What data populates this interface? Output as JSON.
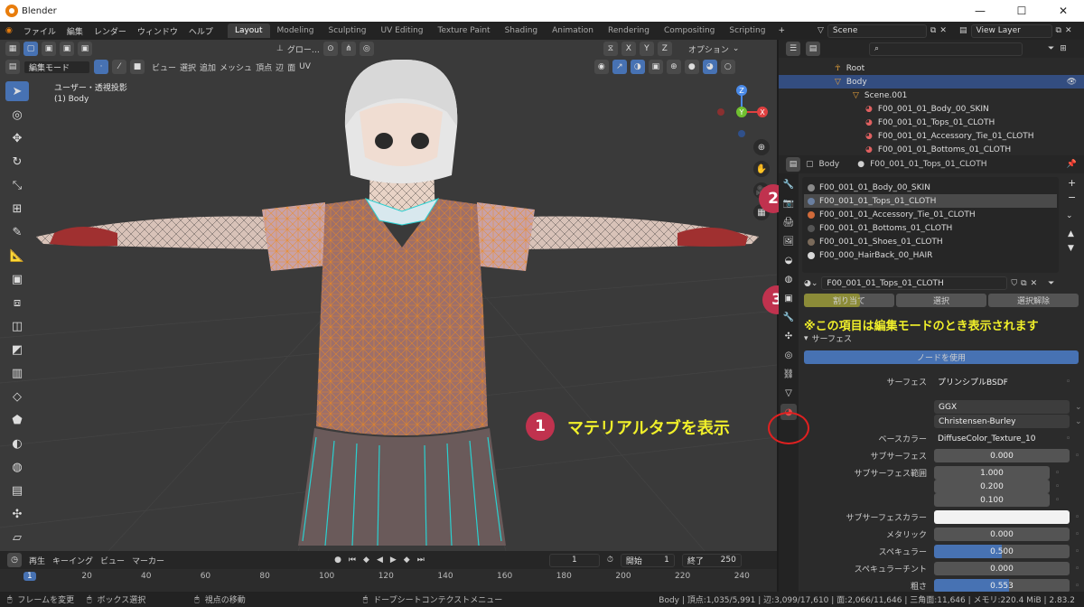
{
  "window": {
    "title": "Blender"
  },
  "menu": [
    "ファイル",
    "編集",
    "レンダー",
    "ウィンドウ",
    "ヘルプ"
  ],
  "workspace_tabs": [
    {
      "label": "Layout",
      "active": true
    },
    {
      "label": "Modeling",
      "active": false
    },
    {
      "label": "Sculpting",
      "active": false
    },
    {
      "label": "UV Editing",
      "active": false
    },
    {
      "label": "Texture Paint",
      "active": false
    },
    {
      "label": "Shading",
      "active": false
    },
    {
      "label": "Animation",
      "active": false
    },
    {
      "label": "Rendering",
      "active": false
    },
    {
      "label": "Compositing",
      "active": false
    },
    {
      "label": "Scripting",
      "active": false
    }
  ],
  "scene": {
    "name": "Scene",
    "view_layer": "View Layer"
  },
  "viewport": {
    "mode": "編集モード",
    "menus": [
      "ビュー",
      "選択",
      "追加",
      "メッシュ",
      "頂点",
      "辺",
      "面",
      "UV"
    ],
    "transform": "グロー…",
    "axes": [
      "X",
      "Y",
      "Z"
    ],
    "options": "オプション",
    "overlay_line1": "ユーザー・透視投影",
    "overlay_line2": "(1) Body",
    "gizmo_axes": {
      "x": "X",
      "y": "Y",
      "z": "Z"
    }
  },
  "outliner": {
    "rows": [
      {
        "label": "Root",
        "selected": false
      },
      {
        "label": "Body",
        "selected": true
      },
      {
        "label": "Scene.001",
        "selected": false
      },
      {
        "label": "F00_001_01_Body_00_SKIN",
        "selected": false
      },
      {
        "label": "F00_001_01_Tops_01_CLOTH",
        "selected": false
      },
      {
        "label": "F00_001_01_Accessory_Tie_01_CLOTH",
        "selected": false
      },
      {
        "label": "F00_001_01_Bottoms_01_CLOTH",
        "selected": false
      }
    ]
  },
  "properties": {
    "breadcrumb_object": "Body",
    "breadcrumb_material": "F00_001_01_Tops_01_CLOTH",
    "material_slots": [
      {
        "label": "F00_001_01_Body_00_SKIN",
        "color": "#8a8a8a",
        "selected": false
      },
      {
        "label": "F00_001_01_Tops_01_CLOTH",
        "color": "#6a7fa0",
        "selected": true
      },
      {
        "label": "F00_001_01_Accessory_Tie_01_CLOTH",
        "color": "#d06a3a",
        "selected": false
      },
      {
        "label": "F00_001_01_Bottoms_01_CLOTH",
        "color": "#555555",
        "selected": false
      },
      {
        "label": "F00_001_01_Shoes_01_CLOTH",
        "color": "#7a6a5a",
        "selected": false
      },
      {
        "label": "F00_000_HairBack_00_HAIR",
        "color": "#d8d8d8",
        "selected": false
      }
    ],
    "material_name": "F00_001_01_Tops_01_CLOTH",
    "assign_label": "割り当て",
    "select_label": "選択",
    "deselect_label": "選択解除",
    "surface_panel": "サーフェス",
    "use_nodes": "ノードを使用",
    "rows": [
      {
        "label": "サーフェス",
        "value": "プリンシプルBSDF",
        "style": "plain"
      },
      {
        "label": "",
        "value": "GGX",
        "style": "sel"
      },
      {
        "label": "",
        "value": "Christensen-Burley",
        "style": "sel"
      },
      {
        "label": "ベースカラー",
        "value": "DiffuseColor_Texture_10",
        "style": "plain"
      },
      {
        "label": "サブサーフェス",
        "value": "0.000",
        "style": "num"
      },
      {
        "label": "サブサーフェス範囲",
        "value": "1.000",
        "style": "num"
      },
      {
        "label": "",
        "value": "0.200",
        "style": "num"
      },
      {
        "label": "",
        "value": "0.100",
        "style": "num"
      },
      {
        "label": "サブサーフェスカラー",
        "value": "",
        "style": "white"
      },
      {
        "label": "メタリック",
        "value": "0.000",
        "style": "num"
      },
      {
        "label": "スペキュラー",
        "value": "0.500",
        "style": "blue"
      },
      {
        "label": "スペキュラーチント",
        "value": "0.000",
        "style": "num"
      },
      {
        "label": "粗さ",
        "value": "0.553",
        "style": "blue"
      }
    ],
    "specular_fill": 0.5,
    "roughness_fill": 0.553
  },
  "annotations": {
    "badge1": "1",
    "badge2": "2",
    "badge3": "3",
    "note1": "マテリアルタブを表示",
    "note3": "※この項目は編集モードのとき表示されます"
  },
  "timeline": {
    "menus": [
      "再生",
      "キーイング",
      "ビュー",
      "マーカー"
    ],
    "current_frame": "1",
    "start_label": "開始",
    "start": "1",
    "end_label": "終了",
    "end": "250",
    "ticks": [
      "1",
      "20",
      "40",
      "60",
      "80",
      "100",
      "120",
      "140",
      "160",
      "180",
      "200",
      "220",
      "240"
    ]
  },
  "status": {
    "left1": "フレームを変更",
    "left2": "ボックス選択",
    "left3": "視点の移動",
    "left4": "ドープシートコンテクストメニュー",
    "right": "Body | 頂点:1,035/5,991 | 辺:3,099/17,610 | 面:2,066/11,646 | 三角面:11,646 | メモリ:220.4 MiB | 2.83.2"
  },
  "colors": {
    "accent": "#4772b3",
    "badge": "#c0324e",
    "note": "#f1f02a",
    "highlight": "#b8b820"
  }
}
